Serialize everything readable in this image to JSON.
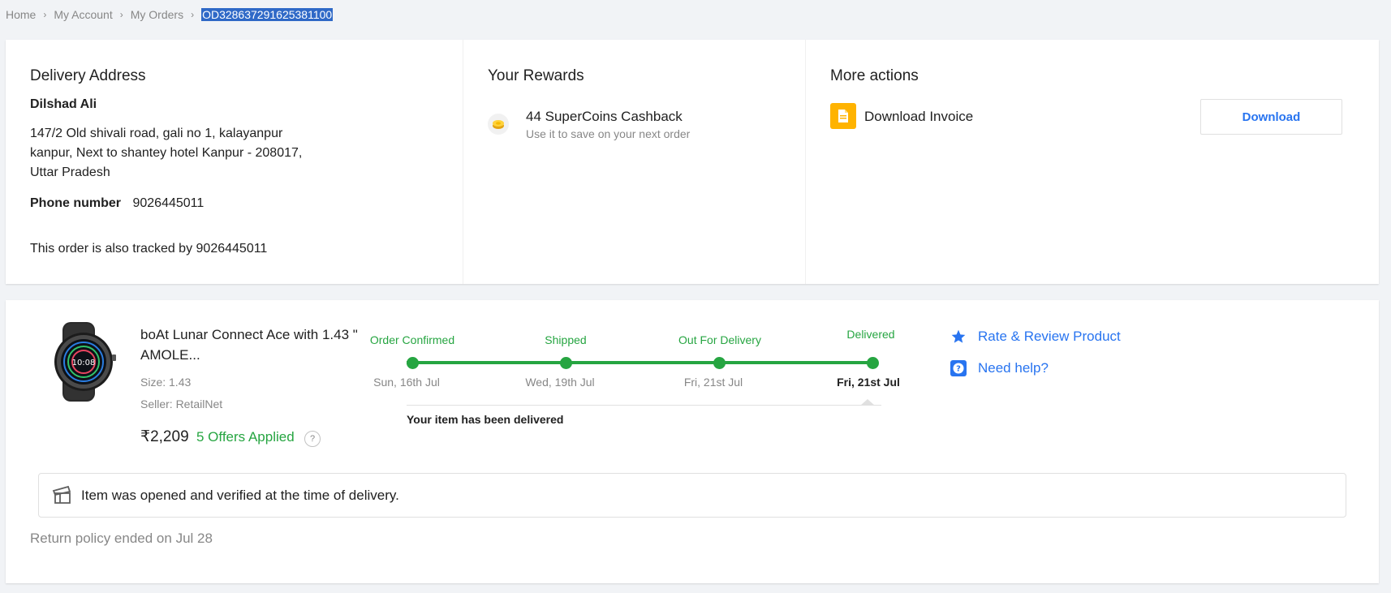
{
  "breadcrumb": {
    "items": [
      "Home",
      "My Account",
      "My Orders"
    ],
    "current": "OD328637291625381100"
  },
  "address": {
    "title": "Delivery Address",
    "name": "Dilshad Ali",
    "line1": "147/2 Old shivali road, gali no 1, kalayanpur",
    "line2": "kanpur, Next to shantey hotel Kanpur - 208017,",
    "line3": "Uttar Pradesh",
    "phone_label": "Phone number",
    "phone": "9026445011",
    "tracked_text": "This order is also tracked by 9026445011"
  },
  "rewards": {
    "title": "Your Rewards",
    "icon": "supercoin-icon",
    "headline": "44 SuperCoins Cashback",
    "sub": "Use it to save on your next order"
  },
  "actions": {
    "title": "More actions",
    "icon": "invoice-icon",
    "invoice_label": "Download Invoice",
    "download_label": "Download"
  },
  "product": {
    "name": "boAt Lunar Connect Ace with 1.43 \" AMOLE...",
    "size": "Size: 1.43",
    "seller": "Seller: RetailNet",
    "price": "₹2,209",
    "offers": "5 Offers Applied",
    "offer_help": "?"
  },
  "tracking": {
    "steps": [
      {
        "label": "Order Confirmed",
        "date": "Sun, 16th Jul"
      },
      {
        "label": "Shipped",
        "date": "Wed, 19th Jul"
      },
      {
        "label": "Out For Delivery",
        "date": "Fri, 21st Jul"
      },
      {
        "label": "Delivered",
        "date": "Fri, 21st Jul"
      }
    ],
    "message": "Your item has been delivered",
    "color": "#26a541"
  },
  "links": {
    "rate": "Rate & Review Product",
    "help": "Need help?"
  },
  "verify_text": "Item was opened and verified at the time of delivery.",
  "return_policy": "Return policy ended on Jul 28",
  "colors": {
    "accent": "#2874f0",
    "success": "#26a541",
    "invoice": "#ffb300"
  }
}
